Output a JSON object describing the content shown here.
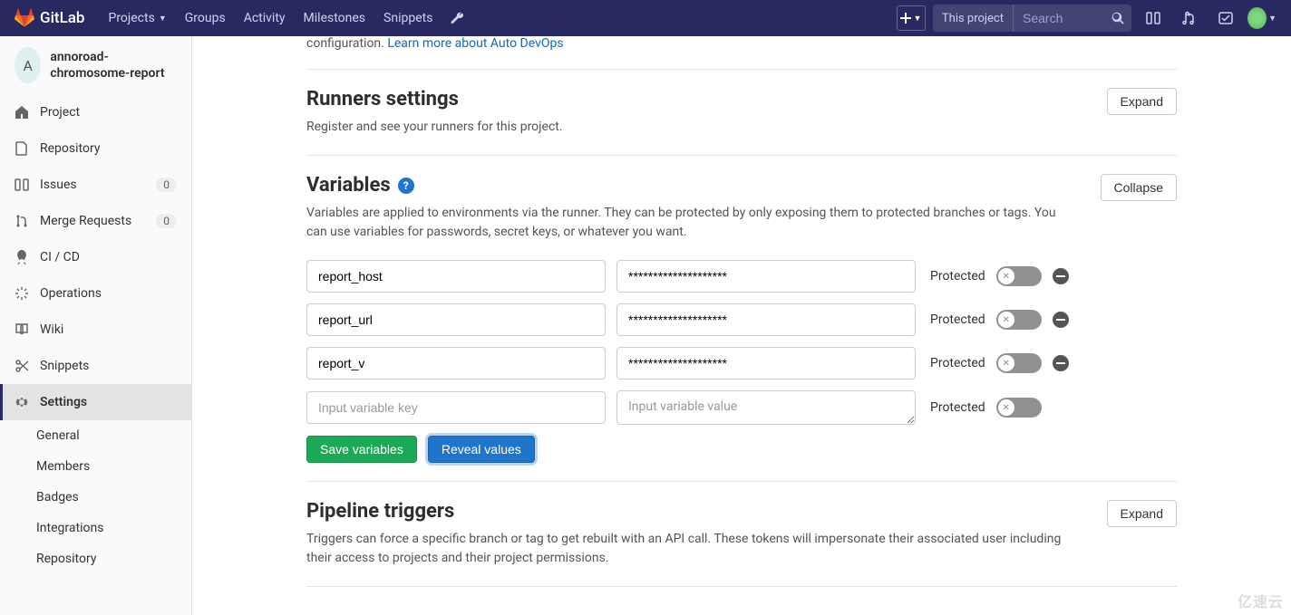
{
  "brand": "GitLab",
  "topnav": {
    "projects": "Projects",
    "groups": "Groups",
    "activity": "Activity",
    "milestones": "Milestones",
    "snippets": "Snippets"
  },
  "search": {
    "scope": "This project",
    "placeholder": "Search"
  },
  "project": {
    "initial": "A",
    "name": "annoroad-chromosome-report"
  },
  "sidebar": {
    "project": "Project",
    "repository": "Repository",
    "issues": "Issues",
    "issues_count": "0",
    "merge_requests": "Merge Requests",
    "mr_count": "0",
    "cicd": "CI / CD",
    "operations": "Operations",
    "wiki": "Wiki",
    "snippets": "Snippets",
    "settings": "Settings",
    "sub": {
      "general": "General",
      "members": "Members",
      "badges": "Badges",
      "integrations": "Integrations",
      "repository": "Repository"
    }
  },
  "partial": {
    "text_prefix": "configuration. ",
    "link": "Learn more about Auto DevOps"
  },
  "runners": {
    "title": "Runners settings",
    "desc": "Register and see your runners for this project.",
    "btn": "Expand"
  },
  "variables": {
    "title": "Variables",
    "btn": "Collapse",
    "desc": "Variables are applied to environments via the runner. They can be protected by only exposing them to protected branches or tags. You can use variables for passwords, secret keys, or whatever you want.",
    "protected_label": "Protected",
    "rows": [
      {
        "key": "report_host",
        "value": "********************"
      },
      {
        "key": "report_url",
        "value": "********************"
      },
      {
        "key": "report_v",
        "value": "********************"
      }
    ],
    "key_placeholder": "Input variable key",
    "value_placeholder": "Input variable value",
    "save_btn": "Save variables",
    "reveal_btn": "Reveal values"
  },
  "triggers": {
    "title": "Pipeline triggers",
    "btn": "Expand",
    "desc": "Triggers can force a specific branch or tag to get rebuilt with an API call. These tokens will impersonate their associated user including their access to projects and their project permissions."
  },
  "watermark": "亿速云"
}
